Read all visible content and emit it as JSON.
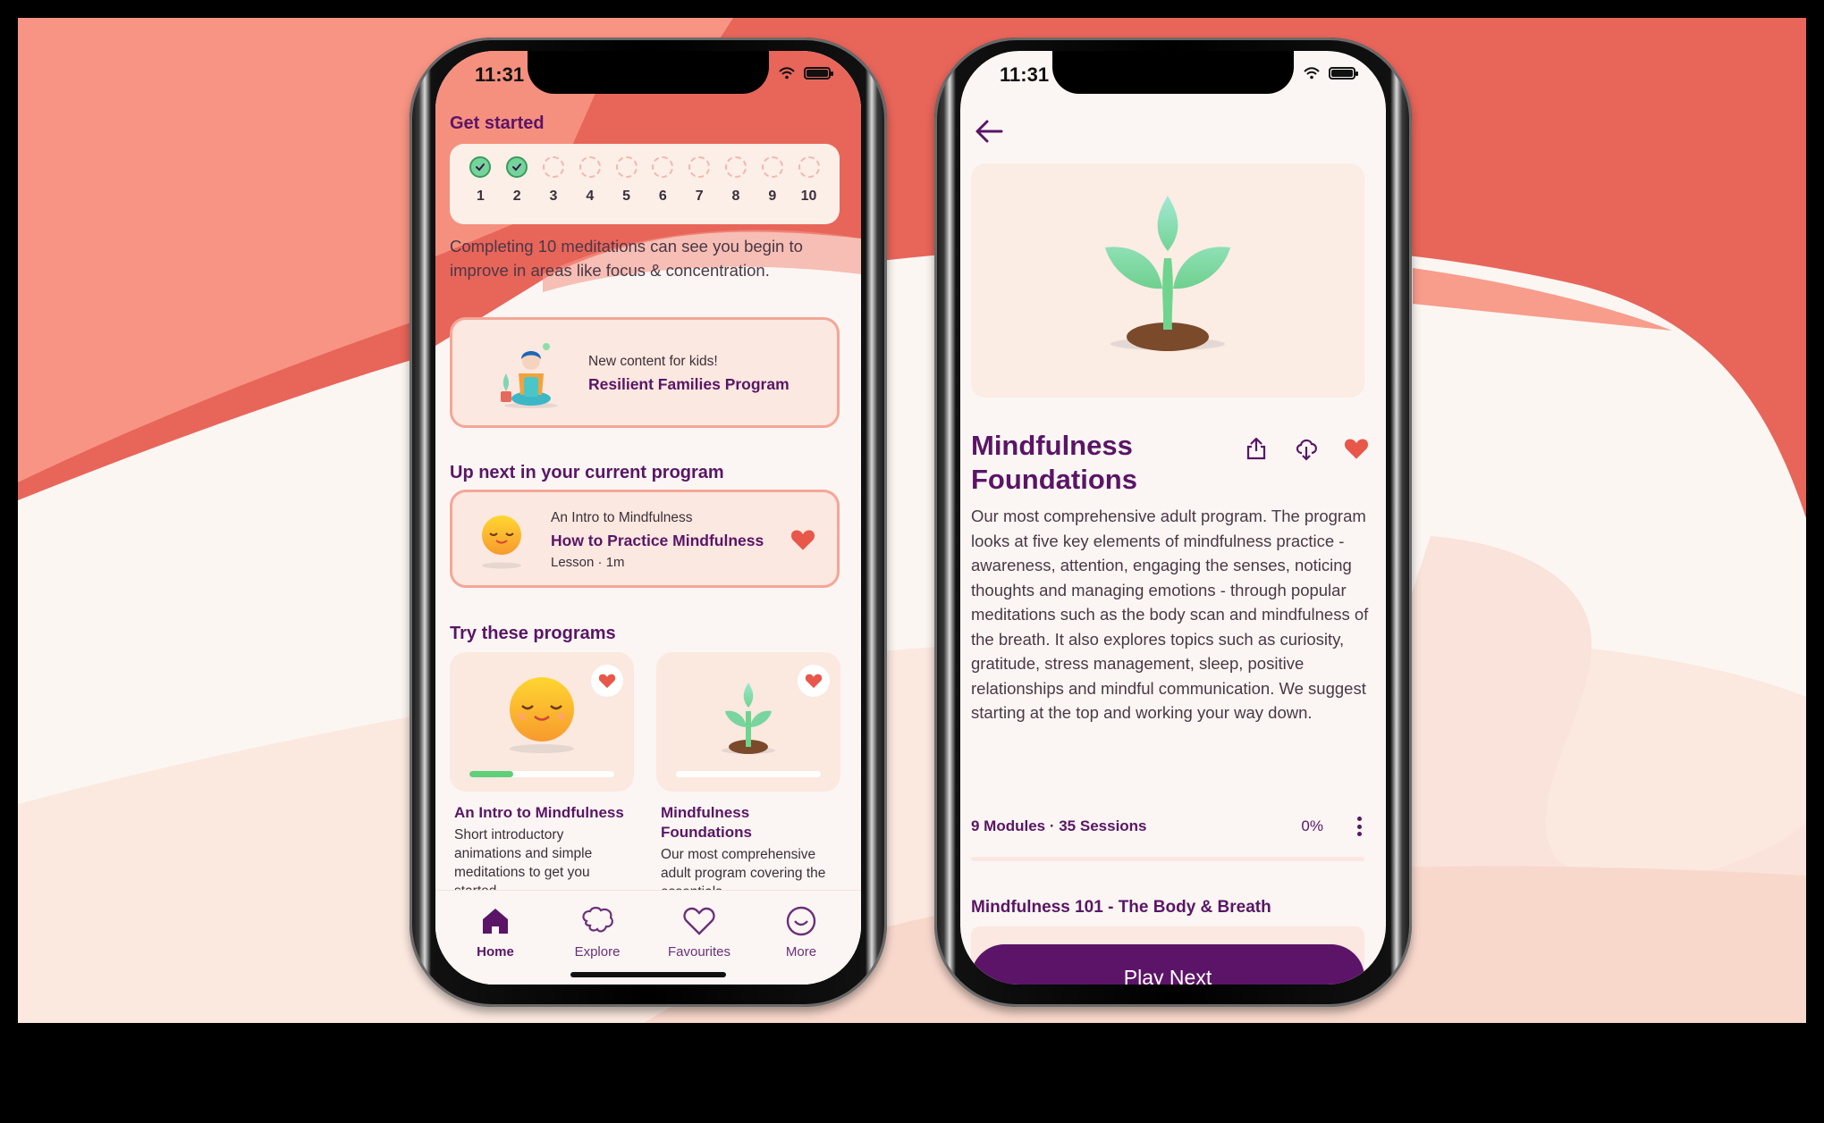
{
  "colors": {
    "brand_purple": "#5a1566",
    "coral": "#e8655a",
    "heart_red": "#e8574a",
    "success_green": "#5fcf7a",
    "cream": "#fbf6f3"
  },
  "home_screen": {
    "status": {
      "time": "11:31"
    },
    "get_started": {
      "heading": "Get started",
      "steps": [
        {
          "label": "1",
          "completed": true
        },
        {
          "label": "2",
          "completed": true
        },
        {
          "label": "3",
          "completed": false
        },
        {
          "label": "4",
          "completed": false
        },
        {
          "label": "5",
          "completed": false
        },
        {
          "label": "6",
          "completed": false
        },
        {
          "label": "7",
          "completed": false
        },
        {
          "label": "8",
          "completed": false
        },
        {
          "label": "9",
          "completed": false
        },
        {
          "label": "10",
          "completed": false
        }
      ],
      "description": "Completing 10 meditations can see you begin to improve in areas like focus & concentration."
    },
    "promo": {
      "subtitle": "New content for kids!",
      "title": "Resilient Families Program",
      "icon": "meditating-child-illustration"
    },
    "up_next": {
      "heading": "Up next in your current program",
      "program": "An Intro to Mindfulness",
      "title": "How to Practice Mindfulness",
      "meta": "Lesson · 1m",
      "favourited": true,
      "icon": "smiling-face-illustration"
    },
    "programs": {
      "heading": "Try these programs",
      "items": [
        {
          "title": "An Intro to Mindfulness",
          "description": "Short introductory animations and simple meditations to get you started",
          "progress": 0.3,
          "favourited": true,
          "icon": "smiling-face-illustration"
        },
        {
          "title": "Mindfulness Foundations",
          "description": "Our most comprehensive adult program covering the essentials",
          "progress": 0,
          "favourited": true,
          "icon": "sprout-illustration"
        }
      ]
    },
    "tabbar": [
      {
        "label": "Home",
        "icon": "home-icon",
        "active": true
      },
      {
        "label": "Explore",
        "icon": "brain-icon",
        "active": false
      },
      {
        "label": "Favourites",
        "icon": "heart-outline-icon",
        "active": false
      },
      {
        "label": "More",
        "icon": "smile-icon",
        "active": false
      }
    ]
  },
  "detail_screen": {
    "status": {
      "time": "11:31"
    },
    "back_icon": "arrow-left-icon",
    "hero_icon": "sprout-illustration",
    "title": "Mindfulness Foundations",
    "actions": [
      {
        "name": "share",
        "icon": "share-icon"
      },
      {
        "name": "download",
        "icon": "cloud-download-icon"
      },
      {
        "name": "favourite",
        "icon": "heart-filled-icon"
      }
    ],
    "description": "Our most comprehensive adult program. The program looks at five key elements of mindfulness practice - awareness, attention, engaging the senses, noticing thoughts and managing emotions - through popular meditations such as the body scan and mindfulness of the breath. It also explores topics such as curiosity, gratitude, stress management, sleep, positive relationships and mindful communication. We suggest starting at the top and working your way down.",
    "meta": "9 Modules · 35 Sessions",
    "progress_label": "0%",
    "module_title": "Mindfulness 101 - The Body & Breath",
    "play_button": "Play Next"
  }
}
